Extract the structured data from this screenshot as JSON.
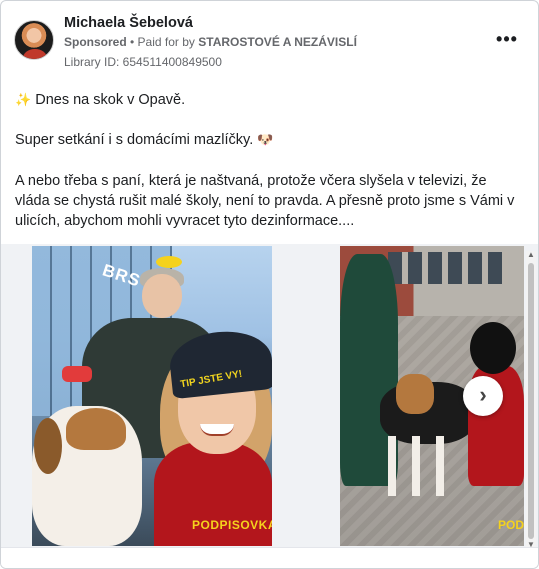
{
  "ad": {
    "author": "Michaela Šebelová",
    "sponsored_label": "Sponsored",
    "separator": " • ",
    "paid_for_prefix": "Paid for by ",
    "payer": "STAROSTOVÉ A NEZÁVISLÍ",
    "library_id": "Library ID: 654511400849500",
    "more_options": "•••"
  },
  "post": {
    "line1_emoji": "✨",
    "line1": "Dnes na skok v Opavě.",
    "line2": "Super setkání i s domácími mazlíčky.",
    "line2_emoji": "🐶",
    "line3": "A nebo třeba s paní, která je naštvaná, protože včera slyšela v televizi, že vláda se chystá rušit malé školy, není to pravda. A přesně proto jsme s Vámi v ulicích, abychom mohli vyvracet tyto dezinformace...."
  },
  "carousel": {
    "slide1_sign": "BRS",
    "slide1_beanie_text": "TIP JSTE VY!",
    "slide1_brand": "PODPISOVKA",
    "slide2_brand": "PODPISOVKA",
    "next_icon": "›"
  },
  "scrollbar": {
    "up_arrow": "▲",
    "down_arrow": "▼"
  }
}
